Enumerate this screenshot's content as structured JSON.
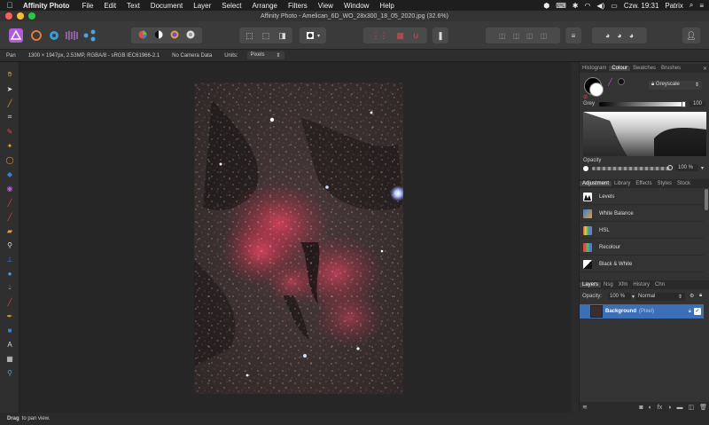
{
  "menubar": {
    "apple": "",
    "app_name": "Affinity Photo",
    "items": [
      "File",
      "Edit",
      "Text",
      "Document",
      "Layer",
      "Select",
      "Arrange",
      "Filters",
      "View",
      "Window",
      "Help"
    ],
    "clock": "Czw. 19:31",
    "user": "Patrix"
  },
  "window": {
    "title": "Affinity Photo - Amelican_6D_WO_28x300_18_05_2020.jpg (32.6%)"
  },
  "context": {
    "tool": "Pan",
    "doc_info": "1300 × 1947px, 2.53MP, RGBA/8 - sRGB IEC61966-2.1",
    "camera": "No Camera Data",
    "units_label": "Units:",
    "units_value": "Pixels"
  },
  "colour_panel": {
    "tabs": [
      "Histogram",
      "Colour",
      "Swatches",
      "Brushes"
    ],
    "active_tab": "Colour",
    "mode": "Greyscale",
    "grey_label": "Grey",
    "grey_value": "100",
    "opacity_label": "Opacity",
    "opacity_value": "100 %"
  },
  "adjustment_panel": {
    "tabs": [
      "Adjustment",
      "Library",
      "Effects",
      "Styles",
      "Stock"
    ],
    "items": [
      "Levels",
      "White Balance",
      "HSL",
      "Recolour",
      "Black & White"
    ]
  },
  "layers_panel": {
    "tabs": [
      "Layers",
      "Nsg",
      "Xfm",
      "History",
      "Chn"
    ],
    "opacity_label": "Opacity:",
    "opacity_value": "100 %",
    "blend_mode": "Normal",
    "layer_name": "Background",
    "layer_type": "(Pixel)"
  },
  "status": {
    "action": "Drag",
    "hint": "to pan view."
  },
  "colors": {
    "accent": "#3b7dd8",
    "selected_layer": "#3d6fb6"
  }
}
